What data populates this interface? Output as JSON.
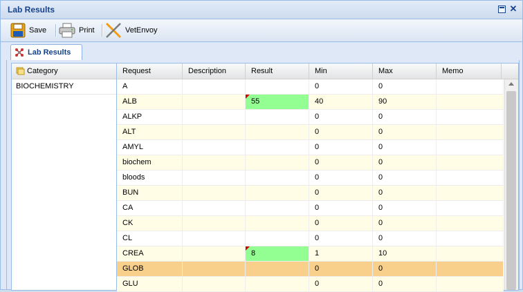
{
  "window": {
    "title": "Lab Results"
  },
  "toolbar": {
    "save_label": "Save",
    "print_label": "Print",
    "vetenvoy_label": "VetEnvoy"
  },
  "tab": {
    "label": "Lab Results"
  },
  "category": {
    "header": "Category",
    "items": [
      "BIOCHEMISTRY"
    ]
  },
  "grid": {
    "columns": [
      "Request",
      "Description",
      "Result",
      "Min",
      "Max",
      "Memo"
    ],
    "rows": [
      {
        "request": "A",
        "description": "",
        "result": "",
        "min": "0",
        "max": "0",
        "memo": ""
      },
      {
        "request": "ALB",
        "description": "",
        "result": "55",
        "min": "40",
        "max": "90",
        "memo": ""
      },
      {
        "request": "ALKP",
        "description": "",
        "result": "",
        "min": "0",
        "max": "0",
        "memo": ""
      },
      {
        "request": "ALT",
        "description": "",
        "result": "",
        "min": "0",
        "max": "0",
        "memo": ""
      },
      {
        "request": "AMYL",
        "description": "",
        "result": "",
        "min": "0",
        "max": "0",
        "memo": ""
      },
      {
        "request": "biochem",
        "description": "",
        "result": "",
        "min": "0",
        "max": "0",
        "memo": ""
      },
      {
        "request": "bloods",
        "description": "",
        "result": "",
        "min": "0",
        "max": "0",
        "memo": ""
      },
      {
        "request": "BUN",
        "description": "",
        "result": "",
        "min": "0",
        "max": "0",
        "memo": ""
      },
      {
        "request": "CA",
        "description": "",
        "result": "",
        "min": "0",
        "max": "0",
        "memo": ""
      },
      {
        "request": "CK",
        "description": "",
        "result": "",
        "min": "0",
        "max": "0",
        "memo": ""
      },
      {
        "request": "CL",
        "description": "",
        "result": "",
        "min": "0",
        "max": "0",
        "memo": ""
      },
      {
        "request": "CREA",
        "description": "",
        "result": "8",
        "min": "1",
        "max": "10",
        "memo": ""
      },
      {
        "request": "GLOB",
        "description": "",
        "result": "",
        "min": "0",
        "max": "0",
        "memo": ""
      },
      {
        "request": "GLU",
        "description": "",
        "result": "",
        "min": "0",
        "max": "0",
        "memo": ""
      }
    ]
  },
  "colors": {
    "title_text": "#15428b",
    "result_in_range": "#93ff93",
    "selected_row": "#f8d08b",
    "alt_row": "#fffde6"
  }
}
